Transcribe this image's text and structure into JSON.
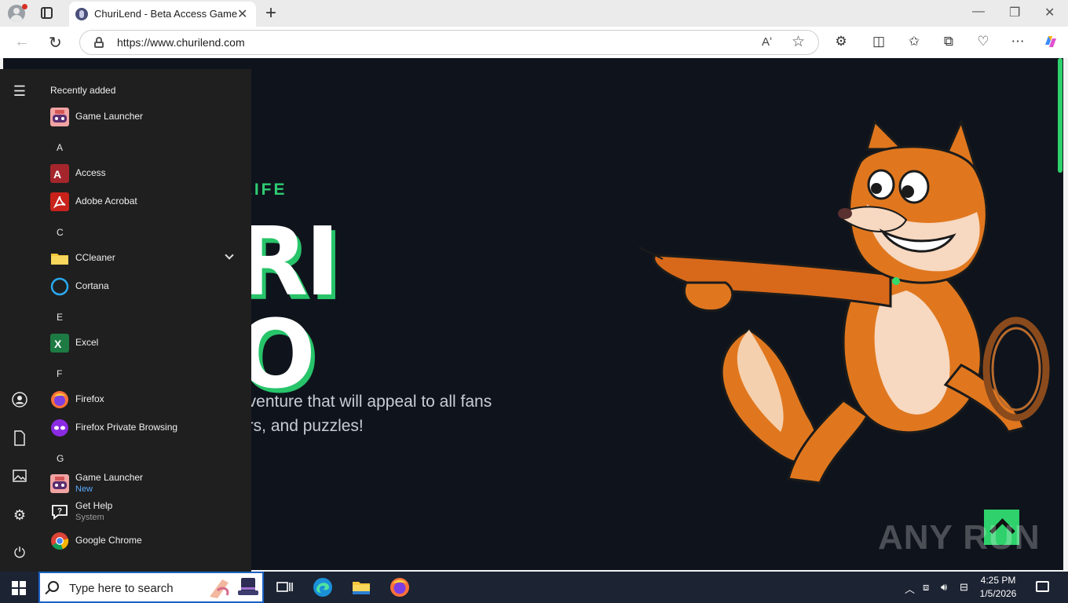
{
  "browser": {
    "tab_title": "ChuriLend - Beta Access Game",
    "url": "https://www.churilend.com",
    "read_aloud_label": "Aʻ"
  },
  "page": {
    "kicker": "LIFE",
    "big_line1": "RI",
    "big_line2": "O",
    "desc_line1": "dventure that will appeal to all fans",
    "desc_line2": "ers, and puzzles!",
    "watermark": "ANY RUN",
    "accent": "#2ecc71"
  },
  "start_menu": {
    "header": "Recently added",
    "recent": [
      {
        "name": "Game Launcher",
        "icon": "game-launcher-icon"
      }
    ],
    "groups": [
      {
        "letter": "A",
        "items": [
          {
            "name": "Access",
            "icon": "access-icon"
          },
          {
            "name": "Adobe Acrobat",
            "icon": "acrobat-icon"
          }
        ]
      },
      {
        "letter": "C",
        "items": [
          {
            "name": "CCleaner",
            "icon": "folder-icon"
          },
          {
            "name": "Cortana",
            "icon": "cortana-icon"
          }
        ]
      },
      {
        "letter": "E",
        "items": [
          {
            "name": "Excel",
            "icon": "excel-icon"
          }
        ]
      },
      {
        "letter": "F",
        "items": [
          {
            "name": "Firefox",
            "icon": "firefox-icon"
          },
          {
            "name": "Firefox Private Browsing",
            "icon": "firefox-private-icon"
          }
        ]
      },
      {
        "letter": "G",
        "items": [
          {
            "name": "Game Launcher",
            "sub": "New",
            "icon": "game-launcher-icon"
          },
          {
            "name": "Get Help",
            "sub": "System",
            "icon": "get-help-icon"
          },
          {
            "name": "Google Chrome",
            "icon": "chrome-icon"
          }
        ]
      }
    ]
  },
  "taskbar": {
    "search_placeholder": "Type here to search",
    "time": "4:25 PM",
    "date": "1/5/2026"
  }
}
